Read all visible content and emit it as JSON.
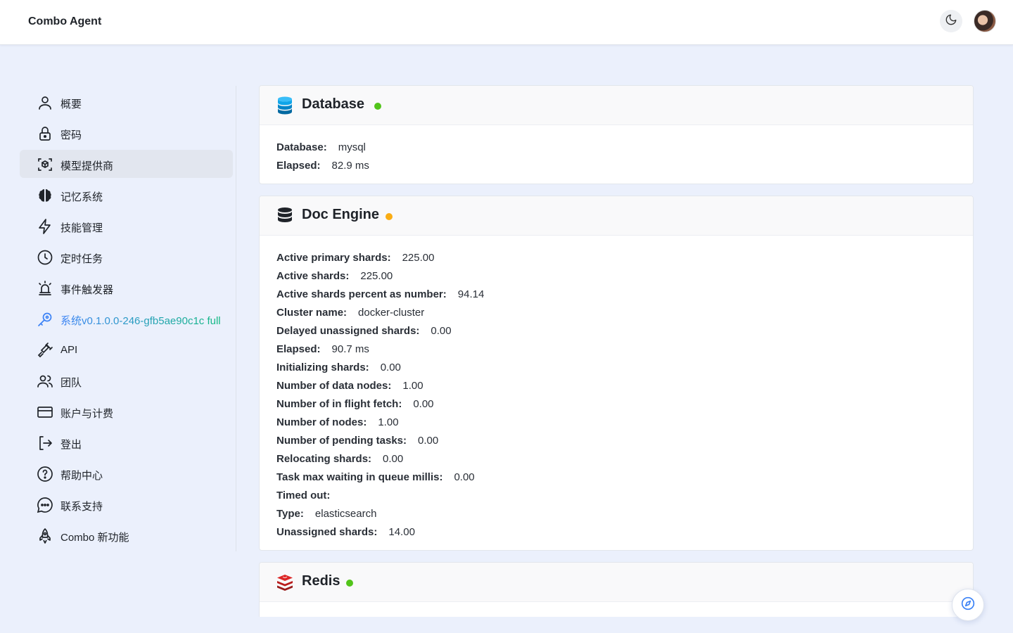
{
  "header": {
    "title": "Combo Agent",
    "theme_toggle_icon": "moon-icon",
    "avatar_icon": "user-avatar"
  },
  "sidebar": {
    "items": [
      {
        "label": "概要",
        "icon": "user-icon"
      },
      {
        "label": "密码",
        "icon": "lock-icon"
      },
      {
        "label": "模型提供商",
        "icon": "cube-scan-icon",
        "active": true
      },
      {
        "label": "记忆系统",
        "icon": "brain-icon"
      },
      {
        "label": "技能管理",
        "icon": "lightning-icon"
      },
      {
        "label": "定时任务",
        "icon": "clock-icon"
      },
      {
        "label": "事件触发器",
        "icon": "siren-icon"
      },
      {
        "label": "系统v0.1.0.0-246-gfb5ae90c1c full",
        "icon": "key-icon",
        "accent": true
      },
      {
        "label": "API",
        "icon": "plug-icon"
      },
      {
        "label": "团队",
        "icon": "users-icon"
      },
      {
        "label": "账户与计费",
        "icon": "credit-card-icon"
      },
      {
        "label": "登出",
        "icon": "logout-icon"
      },
      {
        "label": "帮助中心",
        "icon": "help-circle-icon"
      },
      {
        "label": "联系支持",
        "icon": "chat-bubble-icon"
      },
      {
        "label": "Combo 新功能",
        "icon": "rocket-icon"
      }
    ]
  },
  "cards": {
    "database": {
      "title": "Database",
      "icon": "database-icon",
      "status_color": "#52c41a",
      "rows": [
        {
          "key": "Database:",
          "value": "mysql"
        },
        {
          "key": "Elapsed:",
          "value": "82.9 ms"
        }
      ]
    },
    "doc_engine": {
      "title": "Doc Engine",
      "icon": "server-stack-icon",
      "status_color": "#faad14",
      "rows": [
        {
          "key": "Active primary shards:",
          "value": "225.00"
        },
        {
          "key": "Active shards:",
          "value": "225.00"
        },
        {
          "key": "Active shards percent as number:",
          "value": "94.14"
        },
        {
          "key": "Cluster name:",
          "value": "docker-cluster"
        },
        {
          "key": "Delayed unassigned shards:",
          "value": "0.00"
        },
        {
          "key": "Elapsed:",
          "value": "90.7 ms"
        },
        {
          "key": "Initializing shards:",
          "value": "0.00"
        },
        {
          "key": "Number of data nodes:",
          "value": "1.00"
        },
        {
          "key": "Number of in flight fetch:",
          "value": "0.00"
        },
        {
          "key": "Number of nodes:",
          "value": "1.00"
        },
        {
          "key": "Number of pending tasks:",
          "value": "0.00"
        },
        {
          "key": "Relocating shards:",
          "value": "0.00"
        },
        {
          "key": "Task max waiting in queue millis:",
          "value": "0.00"
        },
        {
          "key": "Timed out:",
          "value": ""
        },
        {
          "key": "Type:",
          "value": "elasticsearch"
        },
        {
          "key": "Unassigned shards:",
          "value": "14.00"
        }
      ]
    },
    "redis": {
      "title": "Redis",
      "icon": "redis-icon",
      "status_color": "#52c41a"
    }
  },
  "fab": {
    "icon": "compass-icon"
  }
}
